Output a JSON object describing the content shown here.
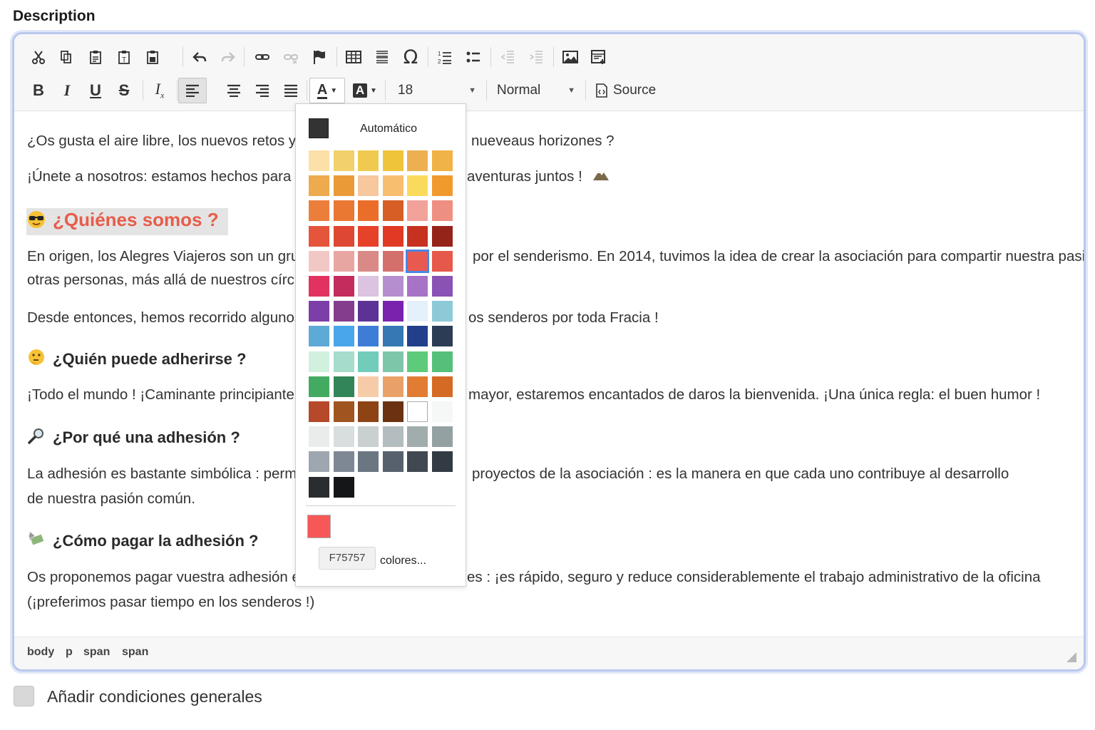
{
  "section_label": "Description",
  "toolbar": {
    "font_size": "18",
    "format": "Normal",
    "source_label": "Source"
  },
  "content": {
    "p1_left": "¿Os gusta el aire libre, los nuevos retos y",
    "p1_right": "nueveaus horizones ?",
    "p2_left": "¡Únete a nosotros: estamos hechos para c",
    "p2_right": "aventuras juntos   !",
    "h_quienes": "¿Quiénes somos ?",
    "p3_line1_left": "En origen, los Alegres Viajeros son un grupo",
    "p3_line1_right": "por el senderismo. En 2014, tuvimos la idea de crear la asociación para compartir nuestra pasión con",
    "p3_line2": "otras personas, más allá de nuestros círculos.",
    "p4_left": "Desde entonces, hemos recorrido algunos d",
    "p4_right": "os senderos por toda Fracia !",
    "h_quien": "¿Quién puede adherirse ?",
    "p5_left": "¡Todo el mundo ! ¡Caminante principiante o ex",
    "p5_right": "mayor, estaremos encantados de daros la bienvenida. ¡Una única regla: el buen humor !",
    "h_porque": "¿Por qué una adhesión ?",
    "p6_line1_left": "La adhesión es bastante simbólica : permite",
    "p6_line1_right": "proyectos de la asociación : es la manera en que cada uno contribuye al desarrollo",
    "p6_line2": "de nuestra pasión común.",
    "h_como": "¿Cómo pagar la adhesión ?",
    "p7_line1_left": "Os proponemos pagar vuestra adhesión en",
    "p7_line1_right": "es : ¡es rápido, seguro y reduce considerablemente el trabajo administrativo de la oficina",
    "p7_line2": "(¡preferimos pasar tiempo en los senderos !)"
  },
  "statusbar": {
    "crumbs": [
      "body",
      "p",
      "span",
      "span"
    ]
  },
  "color_panel": {
    "auto_label": "Automático",
    "auto_color": "#333333",
    "selected_color": "#F75757",
    "hex_value": "F75757",
    "more_label": "colores...",
    "swatches": [
      [
        "#FBE0A8",
        "#F2D06B",
        "#F0C94F",
        "#F0C43A",
        "#EDB050",
        "#F1B246"
      ],
      [
        "#EDAB4E",
        "#EA9B38",
        "#F7C79E",
        "#F7BE70",
        "#F9DA5C",
        "#F09A2E"
      ],
      [
        "#EC7E3C",
        "#EA7833",
        "#EA6E29",
        "#D75E25",
        "#F2A29A",
        "#EF8F82"
      ],
      [
        "#E4553B",
        "#DE4733",
        "#E6422A",
        "#E03A24",
        "#C6321F",
        "#95231A"
      ],
      [
        "#F2C8C6",
        "#E8A6A2",
        "#DA8A86",
        "#D4706C",
        "#E85A4F",
        "#E6584A"
      ],
      [
        "#E23360",
        "#C42C5E",
        "#DBC3E1",
        "#B58ED0",
        "#A773C6",
        "#8A52B5"
      ],
      [
        "#7B3FA7",
        "#843C8D",
        "#5D3296",
        "#7A22AE",
        "#E4F0FA",
        "#8CCAD8"
      ],
      [
        "#5EAAD6",
        "#49A6E8",
        "#3E7DD7",
        "#3578B3",
        "#213F8B",
        "#2C3C55"
      ],
      [
        "#D2F0DE",
        "#A6DCCB",
        "#72CCBA",
        "#7EC6A9",
        "#5ECB7B",
        "#55C07A"
      ],
      [
        "#43AB61",
        "#328558",
        "#F6CBA8",
        "#EAA167",
        "#E17C32",
        "#D56A25"
      ],
      [
        "#B5492A",
        "#A0541F",
        "#8E4314",
        "#6A3211",
        "#FFFFFF",
        "#F6F7F7"
      ],
      [
        "#EAECEC",
        "#D8DDDE",
        "#CACFCF",
        "#B3BCBE",
        "#A1ACAD",
        "#94A1A3"
      ],
      [
        "#9EA6AF",
        "#7E8894",
        "#6A7682",
        "#56616D",
        "#404952",
        "#323A44"
      ],
      [
        "#2A2D30",
        "#151617"
      ]
    ]
  },
  "terms_label": "Añadir condiciones generales"
}
